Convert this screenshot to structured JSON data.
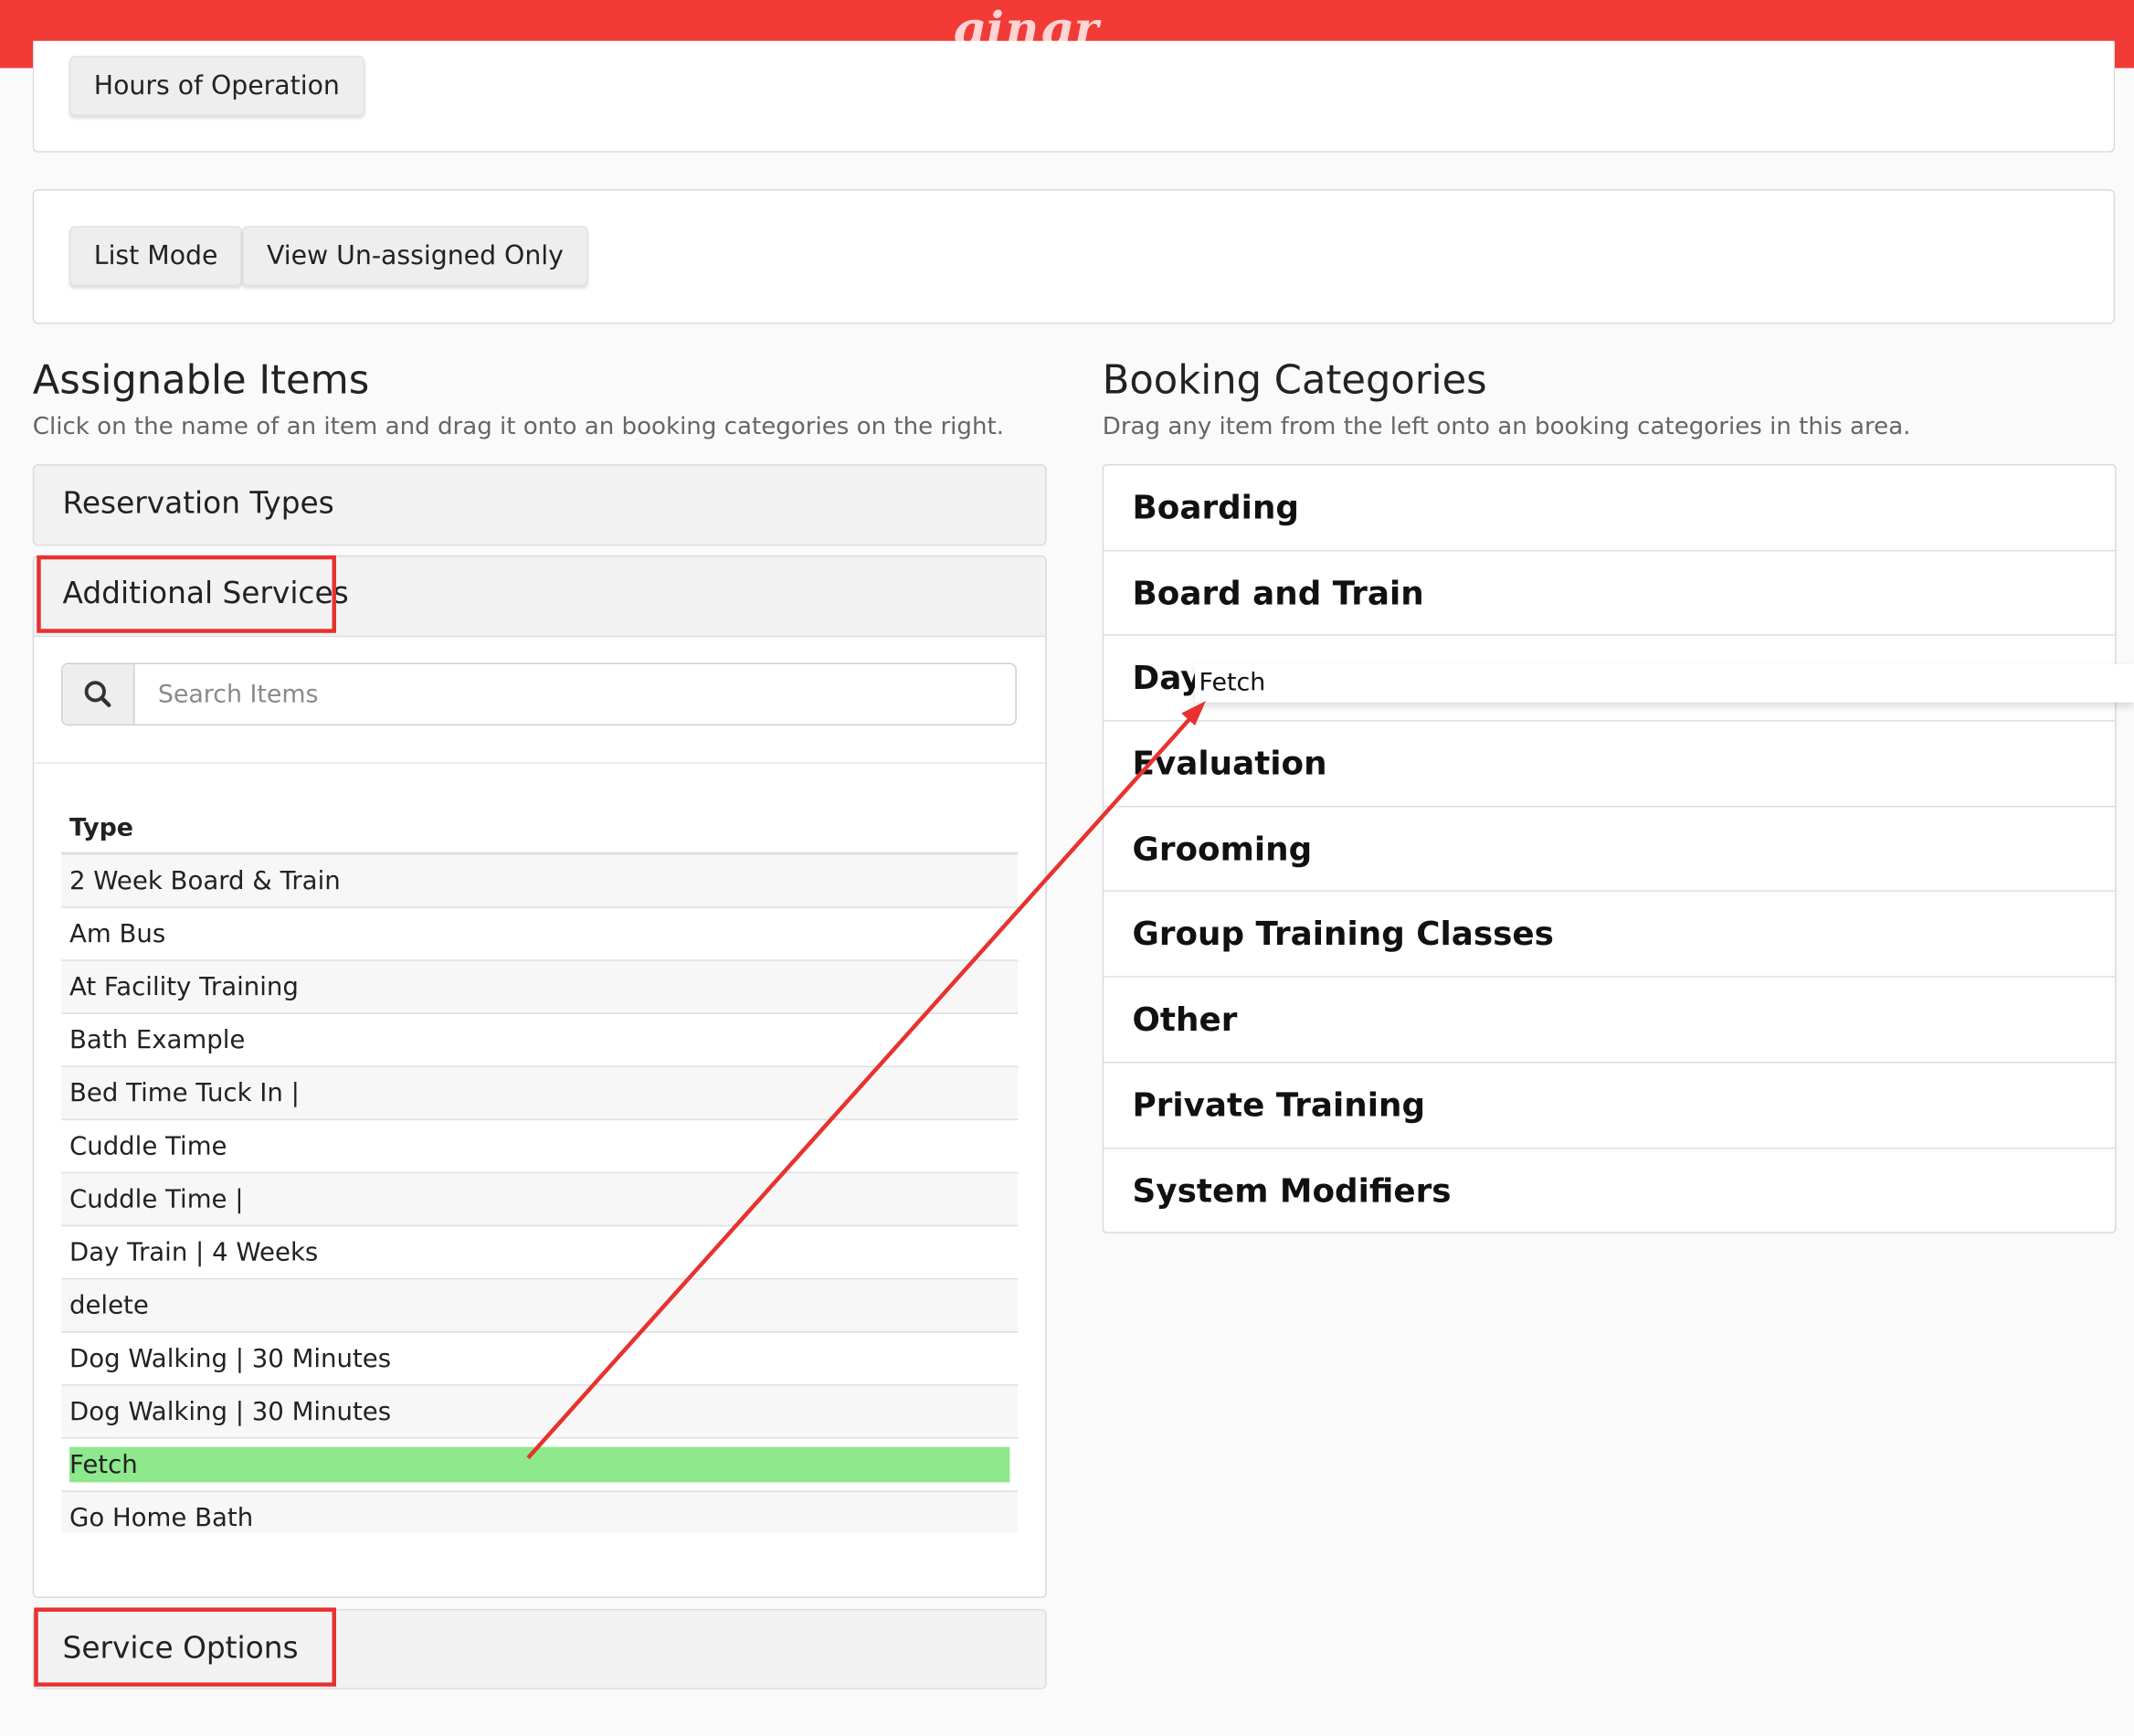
{
  "brand": {
    "logo_text": "gingr",
    "bar_color": "#f23b37"
  },
  "top_panel": {
    "hours_button": "Hours of Operation"
  },
  "mode_panel": {
    "list_mode_button": "List Mode",
    "unassigned_button": "View Un-assigned Only"
  },
  "assignable": {
    "title": "Assignable Items",
    "subtitle": "Click on the name of an item and drag it onto an booking categories on the right.",
    "sections": {
      "reservation_types": "Reservation Types",
      "additional_services": "Additional Services",
      "service_options": "Service Options"
    },
    "search": {
      "placeholder": "Search Items",
      "icon": "search-icon"
    },
    "table_header": "Type",
    "items": [
      "2 Week Board & Train",
      "Am Bus",
      "At Facility Training",
      "Bath Example",
      "Bed Time Tuck In |",
      "Cuddle Time",
      "Cuddle Time |",
      "Day Train | 4 Weeks",
      "delete",
      "Dog Walking | 30 Minutes",
      "Dog Walking | 30 Minutes",
      "Fetch",
      "Go Home Bath"
    ],
    "highlighted_item": "Fetch"
  },
  "booking": {
    "title": "Booking Categories",
    "subtitle": "Drag any item from the left onto an booking categories in this area.",
    "categories": [
      "Boarding",
      "Board and Train",
      "Day",
      "Evaluation",
      "Grooming",
      "Group Training Classes",
      "Other",
      "Private Training",
      "System Modifiers"
    ],
    "drag_helper_text": "Fetch"
  },
  "colors": {
    "highlight": "#8ee88c",
    "annotation_red": "#e8322f"
  }
}
